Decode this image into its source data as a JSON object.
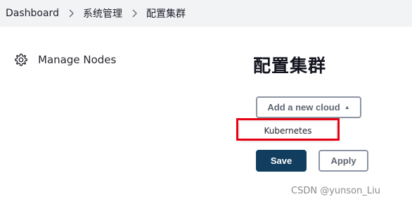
{
  "breadcrumb": {
    "items": [
      "Dashboard",
      "系统管理",
      "配置集群"
    ]
  },
  "sidebar": {
    "items": [
      {
        "label": "Manage Nodes",
        "icon": "gear-icon"
      }
    ]
  },
  "main": {
    "title": "配置集群",
    "add_cloud_label": "Add a new cloud",
    "add_cloud_icon": "caret-up-icon",
    "dropdown_items": [
      "Kubernetes"
    ],
    "save_label": "Save",
    "apply_label": "Apply"
  },
  "watermark": "CSDN @yunson_Liu",
  "colors": {
    "breadcrumb_bg": "#f2f3f5",
    "save_bg": "#113e5f",
    "highlight": "#e60012",
    "button_border": "#8c95a3"
  }
}
